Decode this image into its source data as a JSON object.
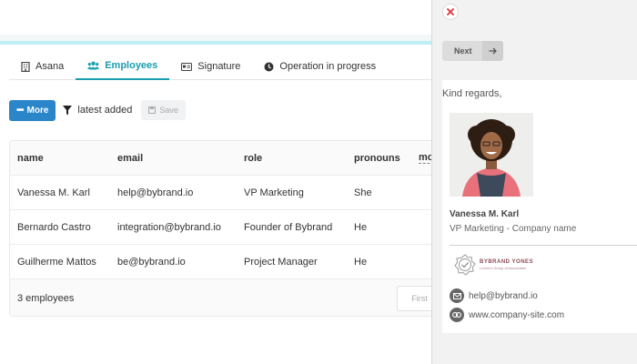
{
  "tabs": [
    {
      "label": "Asana",
      "icon": "building-icon"
    },
    {
      "label": "Employees",
      "icon": "users-icon"
    },
    {
      "label": "Signature",
      "icon": "id-card-icon"
    },
    {
      "label": "Operation in progress",
      "icon": "clock-icon"
    }
  ],
  "toolbar": {
    "more_label": "More",
    "filter_label": "latest added",
    "save_label": "Save"
  },
  "table": {
    "columns": [
      "name",
      "email",
      "role",
      "pronouns",
      "mo"
    ],
    "rows": [
      [
        "Vanessa M. Karl",
        "help@bybrand.io",
        "VP Marketing",
        "She"
      ],
      [
        "Bernardo Castro",
        "integration@bybrand.io",
        "Founder of Bybrand",
        "He"
      ],
      [
        "Guilherme Mattos",
        "be@bybrand.io",
        "Project Manager",
        "He"
      ]
    ],
    "count_label": "3 employees",
    "first_label": "First"
  },
  "panel": {
    "next_label": "Next",
    "signature": {
      "greeting": "Kind regards,",
      "name": "Vanessa M. Karl",
      "role": "VP Marketing - Company name",
      "logo_title": "BYBRAND YONES",
      "logo_sub": "Lorem's Group of Associates",
      "email": "help@bybrand.io",
      "website": "www.company-site.com"
    }
  },
  "colors": {
    "accent": "#1a9eb0",
    "primary_button": "#2a86c9",
    "close_icon": "#e0333a"
  }
}
